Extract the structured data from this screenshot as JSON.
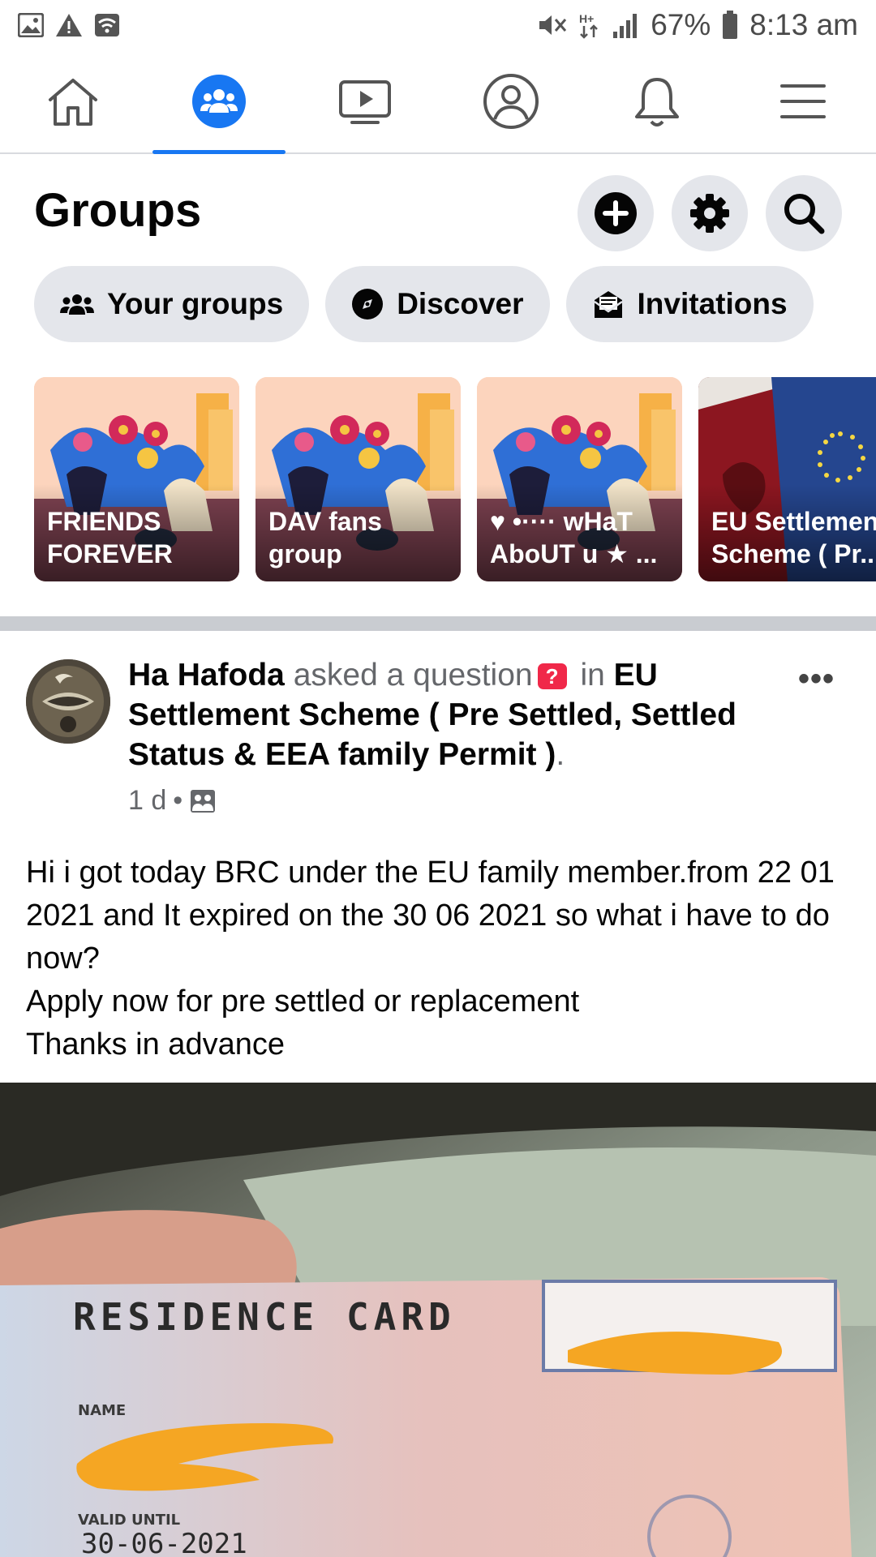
{
  "status_bar": {
    "battery": "67%",
    "time": "8:13 am",
    "icons": [
      "image-icon",
      "warning-icon",
      "wifi-icon",
      "mute-icon",
      "network-icon",
      "signal-icon",
      "battery-icon"
    ]
  },
  "nav": {
    "items": [
      {
        "name": "home",
        "icon": "home-icon",
        "active": false
      },
      {
        "name": "groups",
        "icon": "groups-icon",
        "active": true
      },
      {
        "name": "watch",
        "icon": "video-icon",
        "active": false
      },
      {
        "name": "profile",
        "icon": "profile-icon",
        "active": false
      },
      {
        "name": "notifications",
        "icon": "bell-icon",
        "active": false
      },
      {
        "name": "menu",
        "icon": "menu-icon",
        "active": false
      }
    ],
    "accent": "#1877f2"
  },
  "header": {
    "title": "Groups",
    "actions": [
      "plus-icon",
      "gear-icon",
      "search-icon"
    ]
  },
  "chips": [
    {
      "label": "Your groups",
      "icon": "people-icon"
    },
    {
      "label": "Discover",
      "icon": "compass-icon"
    },
    {
      "label": "Invitations",
      "icon": "envelope-icon"
    }
  ],
  "group_cards": [
    {
      "label": "FRIENDS\nFOREVER"
    },
    {
      "label": "DAV  fans\ngroup"
    },
    {
      "label": "♥ •···· wHaT\nAboUT u ★ ..."
    },
    {
      "label": "EU Settlement\nScheme ( Pr..."
    }
  ],
  "post": {
    "author": "Ha Hafoda",
    "action": "asked a question",
    "in_word": "in",
    "group": "EU Settlement Scheme ( Pre Settled, Settled Status & EEA family Permit )",
    "period": ".",
    "time": "1 d",
    "dot": "•",
    "more": "•••",
    "lines": [
      "Hi i got today BRC under the EU family member.from 22 01 2021 and  It expired on the 30 06 2021 so what i have to do now?",
      "Apply now for pre settled or replacement",
      "Thanks in advance"
    ],
    "photo": {
      "card_title": "RESIDENCE CARD",
      "name_label": "NAME",
      "valid_label": "VALID UNTIL",
      "valid_value": "30-06-2021"
    }
  }
}
